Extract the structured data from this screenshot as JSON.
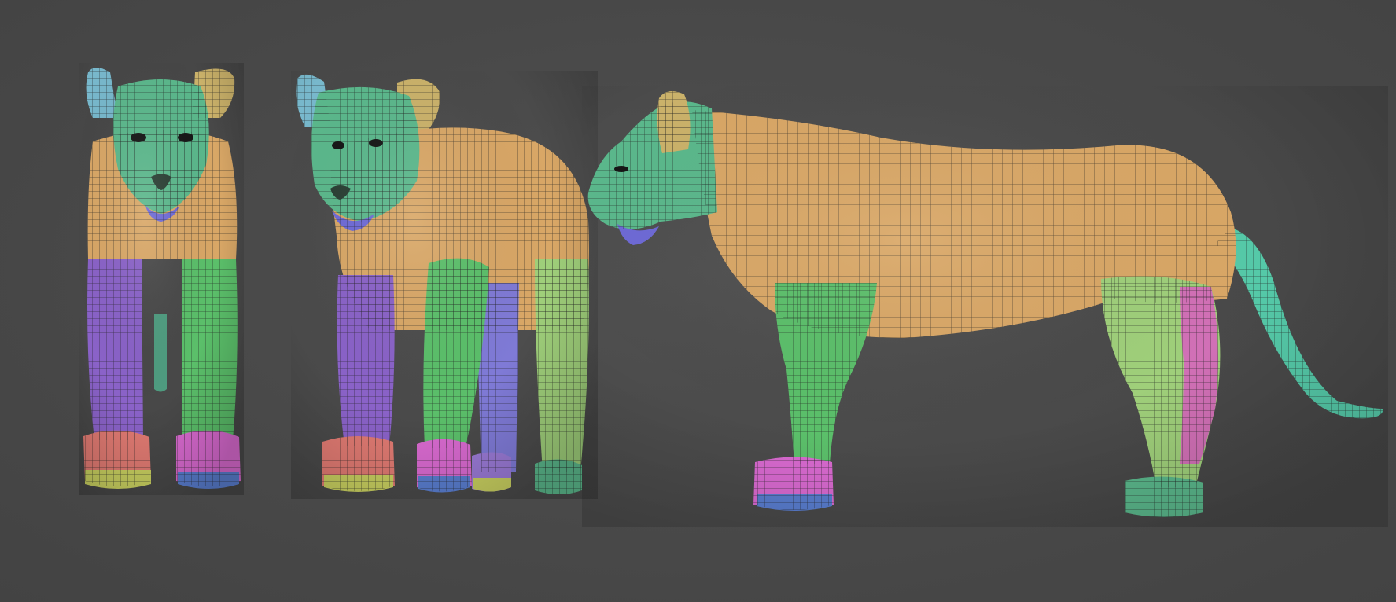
{
  "scene": {
    "background_color": "#474747",
    "views": [
      "front",
      "three-quarter",
      "side"
    ],
    "polygroup_colors": {
      "head": "#5bb88c",
      "body": "#d9a766",
      "front_left_leg": "#8a62c8",
      "front_right_leg": "#5bbf6a",
      "hind_leg": "#9fcf7a",
      "far_leg": "#7f7ad6",
      "paw_red": "#e07a72",
      "paw_pink": "#d96ad0",
      "paw_toes_yellow": "#c9d060",
      "paw_toes_blue": "#5a7ed0",
      "ear_left": "#78b8cc",
      "ear_right": "#cbb26a",
      "tail": "#55c9a8",
      "muzzle_jaw": "#6e6ad6",
      "hind_pink_strip": "#d170b6",
      "wireframe": "#1e1e1e"
    }
  }
}
